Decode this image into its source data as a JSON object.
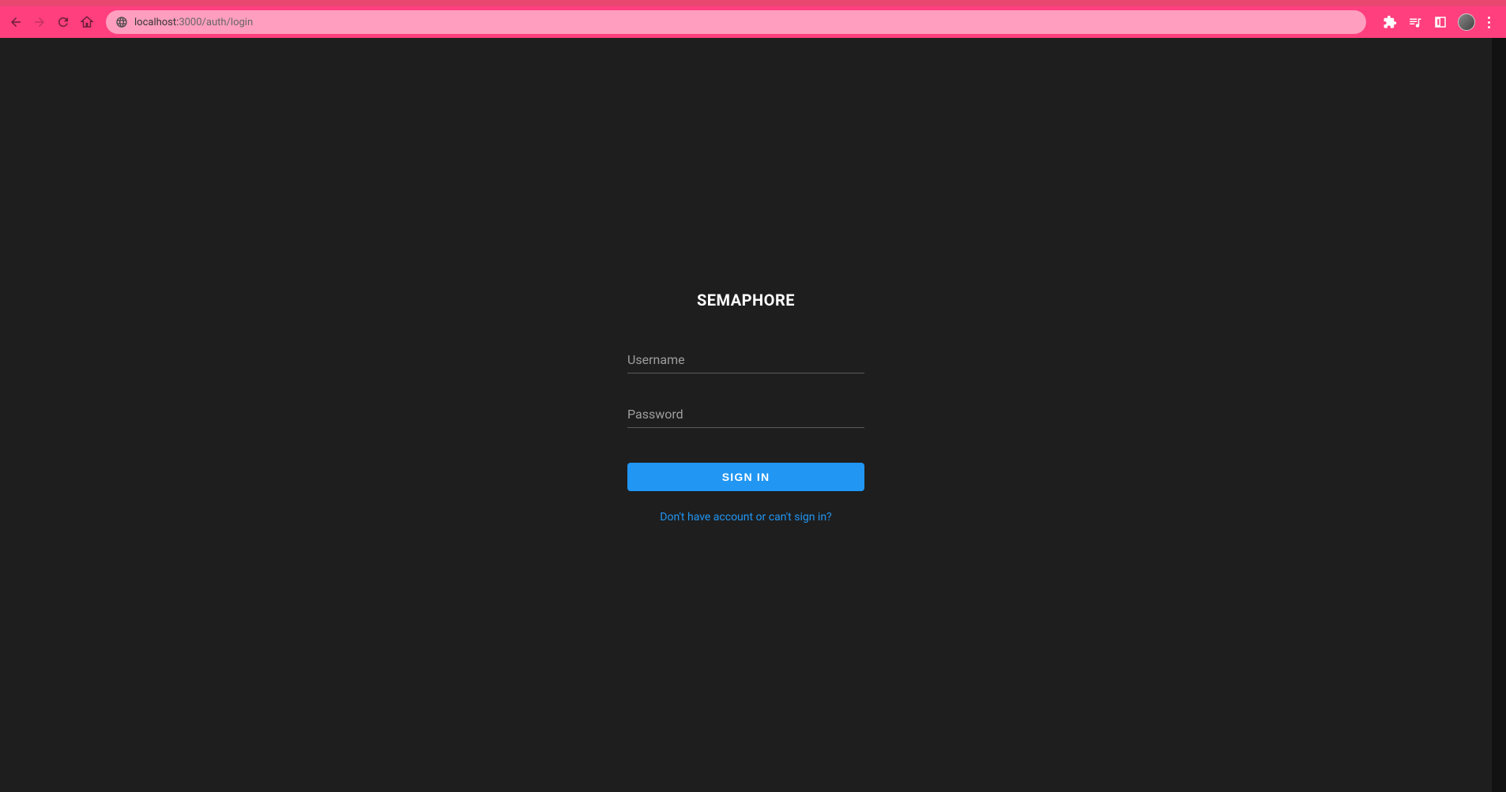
{
  "browser": {
    "url_host": "localhost:",
    "url_port_path": "3000/auth/login"
  },
  "login": {
    "app_title": "SEMAPHORE",
    "username_label": "Username",
    "password_label": "Password",
    "signin_label": "SIGN IN",
    "help_link": "Don't have account or can't sign in?"
  }
}
